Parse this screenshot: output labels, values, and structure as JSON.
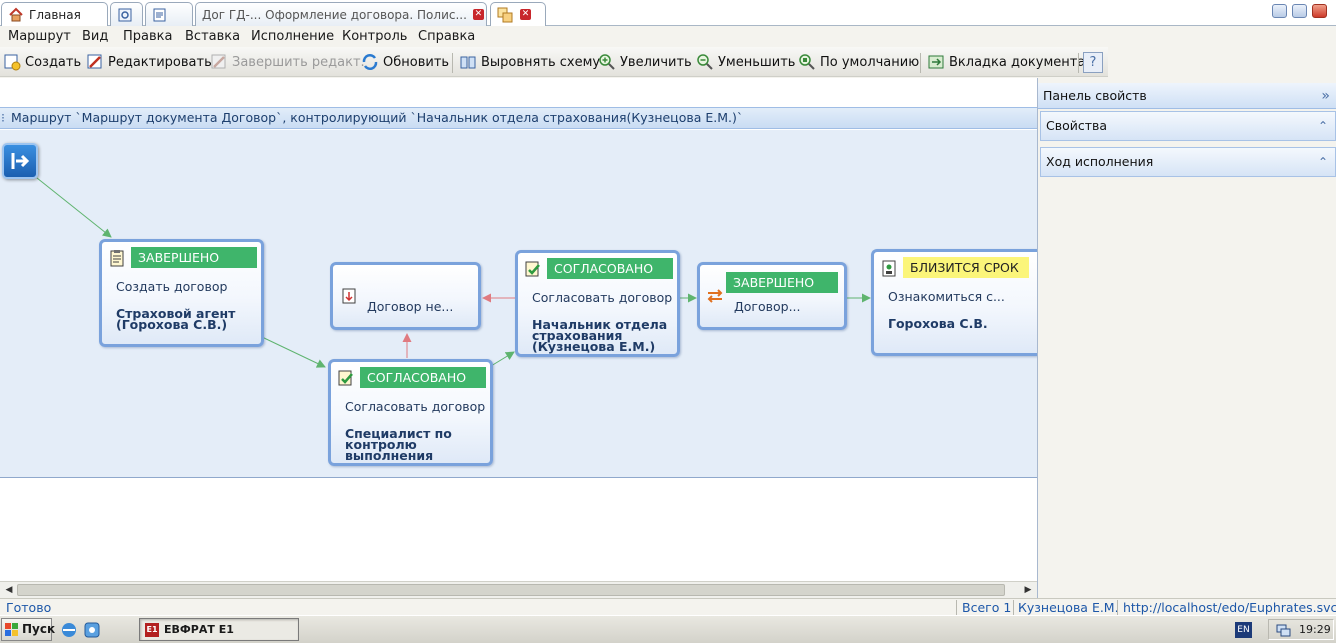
{
  "tabs": [
    {
      "label": "Главная"
    },
    {
      "label": ""
    },
    {
      "label": ""
    },
    {
      "label": "Дог ГД-... Оформление договора. Полис..."
    },
    {
      "label": ""
    }
  ],
  "menu": [
    "Маршрут",
    "Вид",
    "Правка",
    "Вставка",
    "Исполнение",
    "Контроль",
    "Справка"
  ],
  "toolbar": {
    "create": "Создать",
    "edit": "Редактировать",
    "finish_edit": "Завершить редакт.",
    "refresh": "Обновить",
    "align": "Выровнять схему",
    "zoom_in": "Увеличить",
    "zoom_out": "Уменьшить",
    "default_zoom": "По умолчанию",
    "doc_tab": "Вкладка документа",
    "help": "?"
  },
  "route_header": "Маршрут `Маршрут документа Договор`, контролирующий `Начальник отдела страхования(Кузнецова Е.М.)`",
  "nodes": {
    "n1": {
      "status": "ЗАВЕРШЕНО",
      "task": "Создать договор",
      "user_1": "Страховой агент",
      "user_2": "(Горохова С.В.)"
    },
    "n2": {
      "task": "Договор не..."
    },
    "n3": {
      "status": "СОГЛАСОВАНО",
      "task": "Согласовать договор",
      "user_1": "Специалист по",
      "user_2": "контролю",
      "user_3": "выполнения"
    },
    "n4": {
      "status": "СОГЛАСОВАНО",
      "task": "Согласовать договор",
      "user_1": "Начальник отдела",
      "user_2": "страхования",
      "user_3": "(Кузнецова Е.М.)"
    },
    "n5": {
      "status": "ЗАВЕРШЕНО",
      "task": "Договор..."
    },
    "n6": {
      "status": "БЛИЗИТСЯ СРОК",
      "task": "Ознакомиться с...",
      "user_1": "Горохова С.В."
    }
  },
  "panel": {
    "title": "Панель свойств",
    "properties": "Свойства",
    "progress": "Ход исполнения"
  },
  "statusbar": {
    "ready": "Готово",
    "total": "Всего 1",
    "user": "Кузнецова Е.М.",
    "url": "http://localhost/edo/Euphrates.svc/"
  },
  "taskbar": {
    "start": "Пуск",
    "app": "ЕВФРАТ E1",
    "lang": "EN",
    "time": "19:29"
  },
  "colors": {
    "status_green": "#3fb56b",
    "status_yellow": "#fbf57a",
    "arrow_green": "#5fb46f",
    "arrow_red": "#e07a80",
    "node_border": "#7aa2dc"
  }
}
